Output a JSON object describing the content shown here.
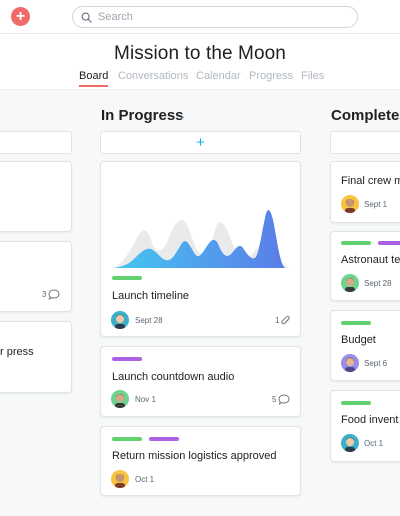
{
  "topbar": {
    "add_icon": "plus-icon",
    "search_placeholder": "Search",
    "search_icon": "search-icon"
  },
  "project": {
    "title": "Mission to the Moon",
    "tabs": [
      {
        "label": "Board",
        "active": true
      },
      {
        "label": "Conversations",
        "active": false
      },
      {
        "label": "Calendar",
        "active": false
      },
      {
        "label": "Progress",
        "active": false
      },
      {
        "label": "Files",
        "active": false
      }
    ]
  },
  "columns": {
    "left": {
      "cards": [
        {
          "comments": "3",
          "comment_icon": "comment-icon"
        },
        {
          "title_fragment": "r press"
        }
      ]
    },
    "in_progress": {
      "title": "In Progress",
      "add_icon": "plus-icon",
      "cards": [
        {
          "title": "Launch timeline",
          "tags": [
            "green"
          ],
          "date": "Sept 28",
          "attachments": "1",
          "attachment_icon": "paperclip-icon",
          "has_chart": true
        },
        {
          "title": "Launch countdown audio",
          "tags": [
            "purple"
          ],
          "date": "Nov 1",
          "comments": "5",
          "comment_icon": "comment-icon"
        },
        {
          "title": "Return mission logistics approved",
          "tags": [
            "green",
            "purple"
          ],
          "date": "Oct 1"
        }
      ]
    },
    "completed": {
      "title": "Completed",
      "cards": [
        {
          "title": "Final crew m",
          "tags": [],
          "date": "Sept 1"
        },
        {
          "title": "Astronaut te",
          "tags": [
            "green",
            "purple"
          ],
          "date": "Sept 28"
        },
        {
          "title": "Budget",
          "tags": [
            "green"
          ],
          "date": "Sept 6"
        },
        {
          "title": "Food invent",
          "tags": [
            "green"
          ],
          "date": "Oct 1"
        }
      ]
    }
  },
  "colors": {
    "accent": "#f06a6a",
    "tag_green": "#62d26f",
    "tag_purple": "#aa62e3",
    "add_blue": "#14aaf5"
  }
}
